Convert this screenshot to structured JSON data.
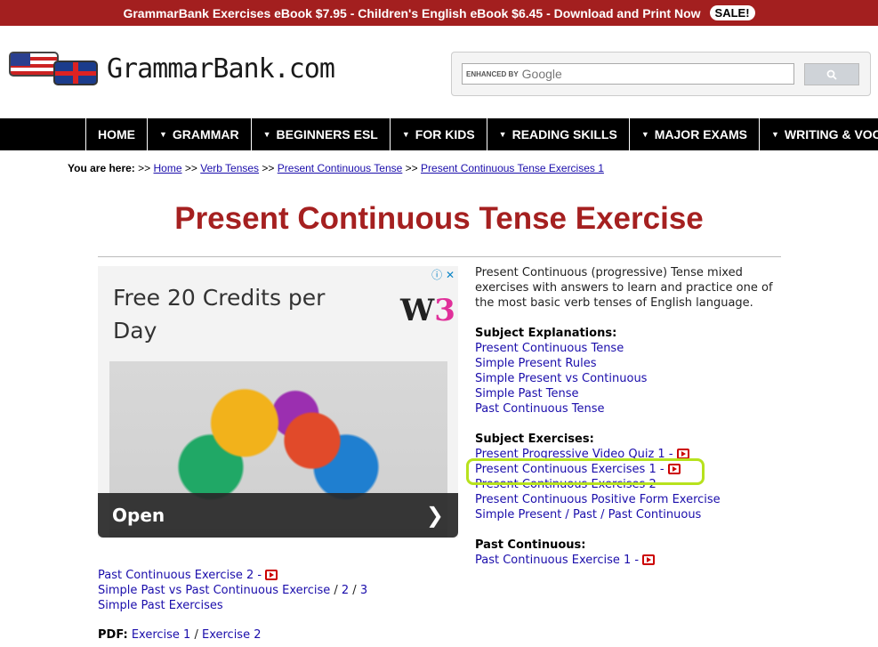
{
  "promo": {
    "text": "GrammarBank Exercises eBook $7.95 - Children's English eBook $6.45 - Download and Print Now",
    "sale": "SALE!"
  },
  "logo": {
    "text": "GrammarBank.com"
  },
  "search": {
    "enhanced": "ENHANCED BY",
    "google": "Google"
  },
  "nav": [
    "HOME",
    "GRAMMAR",
    "BEGINNERS ESL",
    "FOR KIDS",
    "READING SKILLS",
    "MAJOR EXAMS",
    "WRITING & VOCAB"
  ],
  "breadcrumb": {
    "label": "You are here:",
    "sep": ">>",
    "items": [
      "Home",
      "Verb Tenses",
      "Present Continuous Tense",
      "Present Continuous Tense Exercises 1"
    ]
  },
  "title": "Present Continuous Tense Exercise",
  "ad": {
    "headline": "Free 20 Credits per Day",
    "logo_main": "W",
    "logo_accent": "3",
    "cta": "Open",
    "controls": "ⓘ ✕"
  },
  "right": {
    "intro": "Present Continuous (progressive) Tense mixed exercises with answers to learn and practice one of the most basic verb tenses of English language.",
    "explanations_heading": "Subject Explanations:",
    "explanations": [
      "Present Continuous Tense",
      "Simple Present Rules",
      "Simple Present vs Continuous",
      "Simple Past Tense",
      "Past Continuous Tense"
    ],
    "exercises_heading": "Subject Exercises:",
    "exercises": [
      "Present Progressive Video Quiz 1 -",
      "Present Continuous Exercises 1 -",
      "Present Continuous Exercises 2",
      "Present Continuous Positive Form Exercise",
      "Simple Present / Past / Past Continuous"
    ],
    "past_heading": "Past Continuous:",
    "past": [
      "Past Continuous Exercise 1 -"
    ]
  },
  "left_links": {
    "row1": "Past Continuous Exercise 2 -",
    "row2_main": "Simple Past vs Past Continuous Exercise",
    "row2_sep1": " / ",
    "row2_n2": "2",
    "row2_sep2": " / ",
    "row2_n3": "3",
    "row3": "Simple Past Exercises"
  },
  "pdf": {
    "label": "PDF:",
    "ex1": "Exercise 1",
    "sep": " / ",
    "ex2": "Exercise 2"
  }
}
